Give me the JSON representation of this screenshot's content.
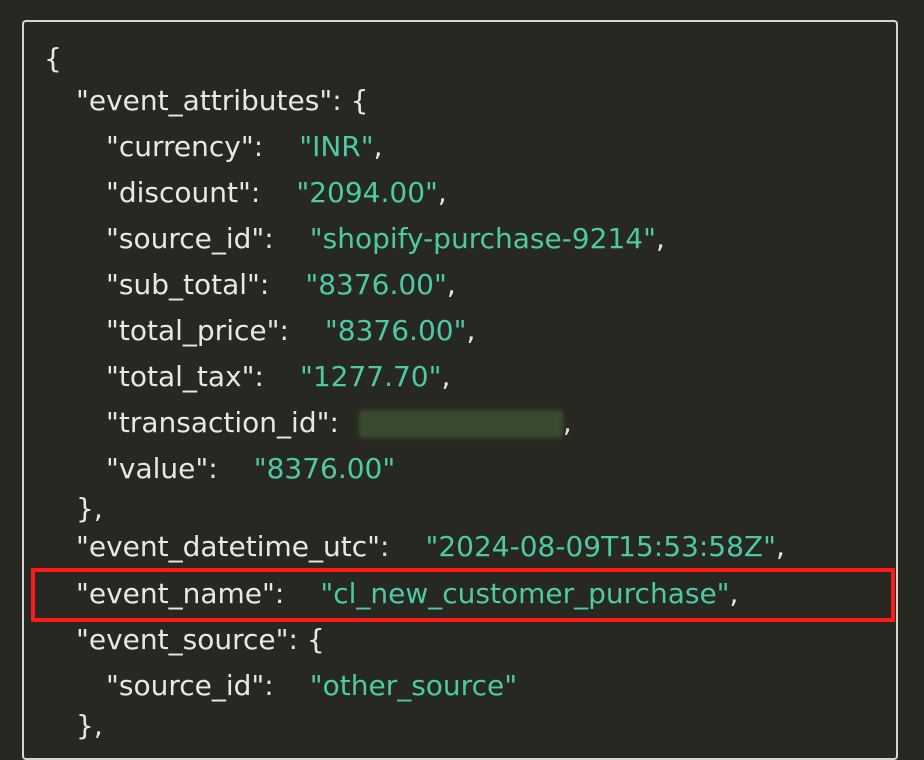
{
  "json_view": {
    "open_brace": "{",
    "lines": [
      {
        "key": "\"event_attributes\"",
        "colon": ": ",
        "value": "",
        "tail": "{"
      },
      {
        "key": "\"currency\"",
        "colon": ":",
        "value": "\"INR\"",
        "tail": ","
      },
      {
        "key": "\"discount\"",
        "colon": ":",
        "value": "\"2094.00\"",
        "tail": ","
      },
      {
        "key": "\"source_id\"",
        "colon": ":",
        "value": "\"shopify-purchase-9214\"",
        "tail": ","
      },
      {
        "key": "\"sub_total\"",
        "colon": ":",
        "value": "\"8376.00\"",
        "tail": ","
      },
      {
        "key": "\"total_price\"",
        "colon": ":",
        "value": "\"8376.00\"",
        "tail": ","
      },
      {
        "key": "\"total_tax\"",
        "colon": ":",
        "value": "\"1277.70\"",
        "tail": ","
      },
      {
        "key": "\"transaction_id\"",
        "colon": ":",
        "value": "",
        "tail": ","
      },
      {
        "key": "\"value\"",
        "colon": ":",
        "value": "\"8376.00\"",
        "tail": ""
      },
      {
        "key": "",
        "colon": "",
        "value": "",
        "tail": "},"
      },
      {
        "key": "\"event_datetime_utc\"",
        "colon": ":",
        "value": "\"2024-08-09T15:53:58Z\"",
        "tail": ","
      },
      {
        "key": "\"event_name\"",
        "colon": ":",
        "value": "\"cl_new_customer_purchase\"",
        "tail": ","
      },
      {
        "key": "\"event_source\"",
        "colon": ": ",
        "value": "",
        "tail": "{"
      },
      {
        "key": "\"source_id\"",
        "colon": ":",
        "value": "\"other_source\"",
        "tail": ""
      },
      {
        "key": "",
        "colon": "",
        "value": "",
        "tail": "},"
      }
    ]
  },
  "colors": {
    "background": "#272822",
    "key_text": "#e8e8e2",
    "string_value": "#4ec9a5",
    "highlight_box": "#ff1a1a"
  }
}
